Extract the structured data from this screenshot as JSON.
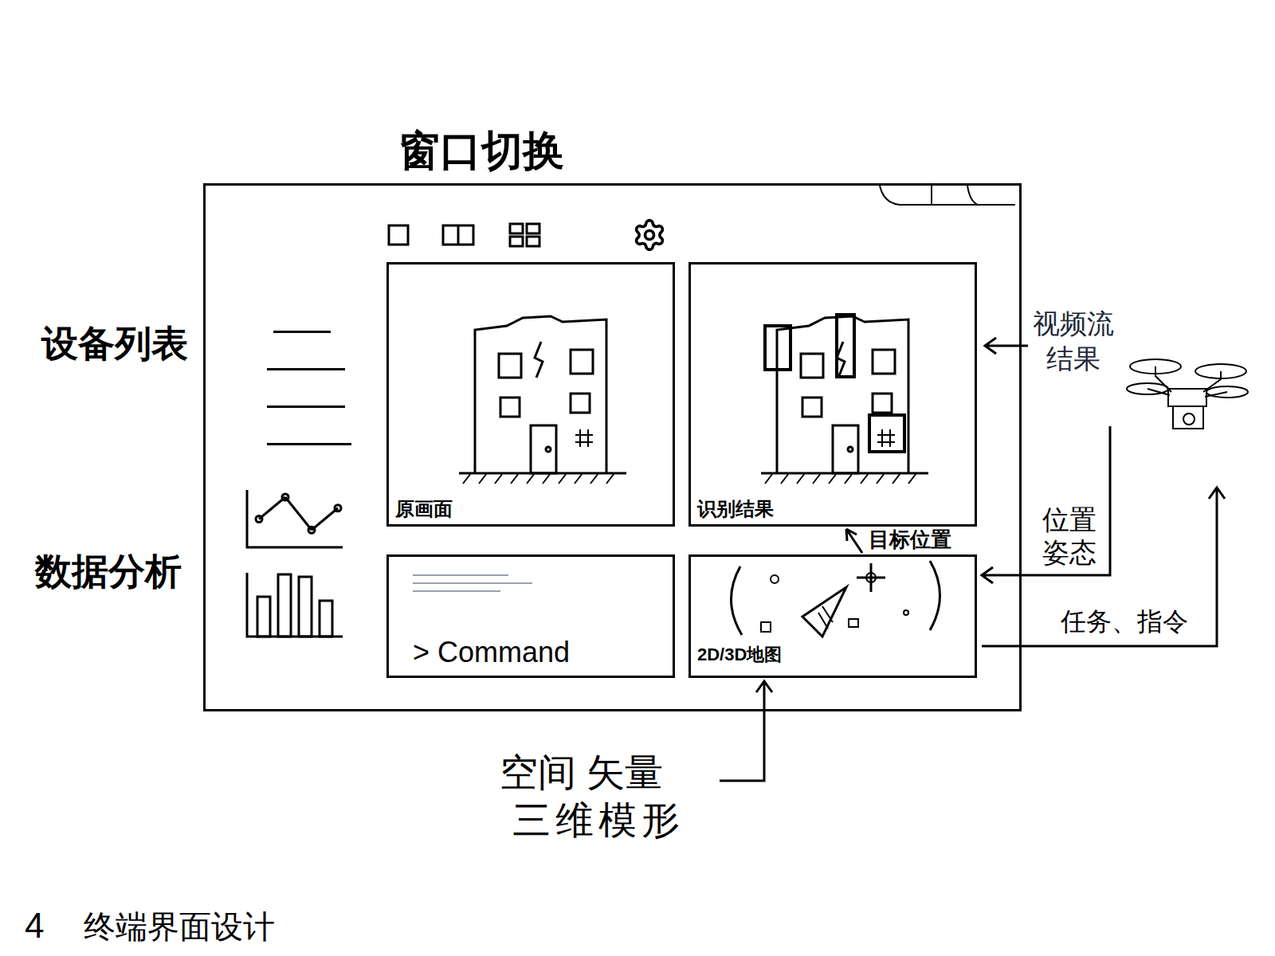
{
  "window": {
    "title": "窗口切换"
  },
  "sidebar": {
    "device_list": {
      "label": "设备列表"
    },
    "data_analysis": {
      "label": "数据分析",
      "line_chart": {
        "values": [
          2,
          4,
          1,
          3
        ]
      },
      "bar_chart": {
        "values": [
          50,
          78,
          75,
          45
        ]
      }
    }
  },
  "panels": {
    "original": {
      "label": "原画面"
    },
    "recognition": {
      "label": "识别结果"
    },
    "command": {
      "prompt": "> Command"
    },
    "map": {
      "label": "2D/3D地图"
    }
  },
  "annotations": {
    "video_stream": [
      "视频流",
      "结果"
    ],
    "pose": [
      "位置",
      "姿态"
    ],
    "task": "任务、指令",
    "target": "目标位置",
    "spatial": [
      "空间 矢量",
      "三维模形"
    ]
  },
  "caption": {
    "number": "4",
    "text": "终端界面设计"
  }
}
